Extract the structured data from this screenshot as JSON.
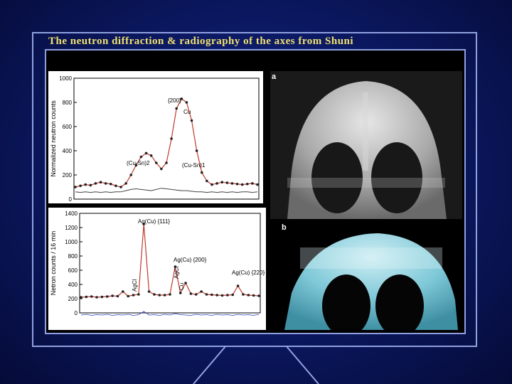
{
  "slide": {
    "title": "The neutron diffraction & radiography of the axes from Shuni"
  },
  "colors": {
    "background": "#0c1a66",
    "frame": "#8fa0e0",
    "title": "#f0e070"
  },
  "images": {
    "label_a": "a",
    "label_b": "b"
  },
  "chart_data": [
    {
      "type": "line",
      "ylabel": "Normalized neutron counts",
      "y_ticks": [
        "0",
        "200",
        "400",
        "600",
        "800",
        "1000"
      ],
      "ylim": [
        0,
        1000
      ],
      "annotations": [
        "{200}",
        "Cu",
        "(Cu-Sn)2",
        "(Cu-Sn)1"
      ],
      "series": [
        {
          "values": [
            100,
            110,
            120,
            115,
            130,
            140,
            130,
            125,
            110,
            100,
            130,
            200,
            280,
            350,
            380,
            360,
            300,
            250,
            300,
            500,
            750,
            830,
            800,
            650,
            400,
            220,
            150,
            120,
            130,
            140,
            135,
            130,
            125,
            120,
            125,
            130,
            120
          ]
        },
        {
          "values": [
            60,
            55,
            60,
            55,
            60,
            55,
            60,
            55,
            60,
            60,
            70,
            80,
            85,
            80,
            75,
            70,
            80,
            90,
            85,
            80,
            75,
            70,
            70,
            65,
            60,
            60,
            55,
            60,
            55,
            60,
            55,
            60,
            55,
            60,
            60,
            55,
            60
          ]
        }
      ]
    },
    {
      "type": "line",
      "ylabel": "Netron counts / 16 min",
      "y_ticks": [
        "0",
        "200",
        "400",
        "600",
        "800",
        "1000",
        "1200",
        "1400"
      ],
      "ylim": [
        0,
        1400
      ],
      "annotations": [
        "Ag(Cu) {111}",
        "Ag(Cu) {200}",
        "Ag(Cu) {220}",
        "AgCl",
        "AgCl",
        "Cu"
      ],
      "series": [
        {
          "values": [
            220,
            225,
            230,
            220,
            225,
            230,
            240,
            235,
            300,
            235,
            250,
            260,
            1250,
            300,
            260,
            250,
            250,
            260,
            650,
            280,
            420,
            270,
            260,
            300,
            260,
            255,
            250,
            245,
            250,
            255,
            380,
            260,
            250,
            245,
            240
          ]
        },
        {
          "values": [
            -30,
            -20,
            -35,
            -25,
            -30,
            -20,
            -35,
            -25,
            -30,
            -20,
            -35,
            -25,
            20,
            -30,
            -25,
            -35,
            -20,
            -30,
            -10,
            -25,
            -30,
            -35,
            -20,
            -30,
            -25,
            -35,
            -20,
            -30,
            -25,
            -35,
            -20,
            -30,
            -25,
            -35,
            -20
          ]
        }
      ]
    }
  ]
}
